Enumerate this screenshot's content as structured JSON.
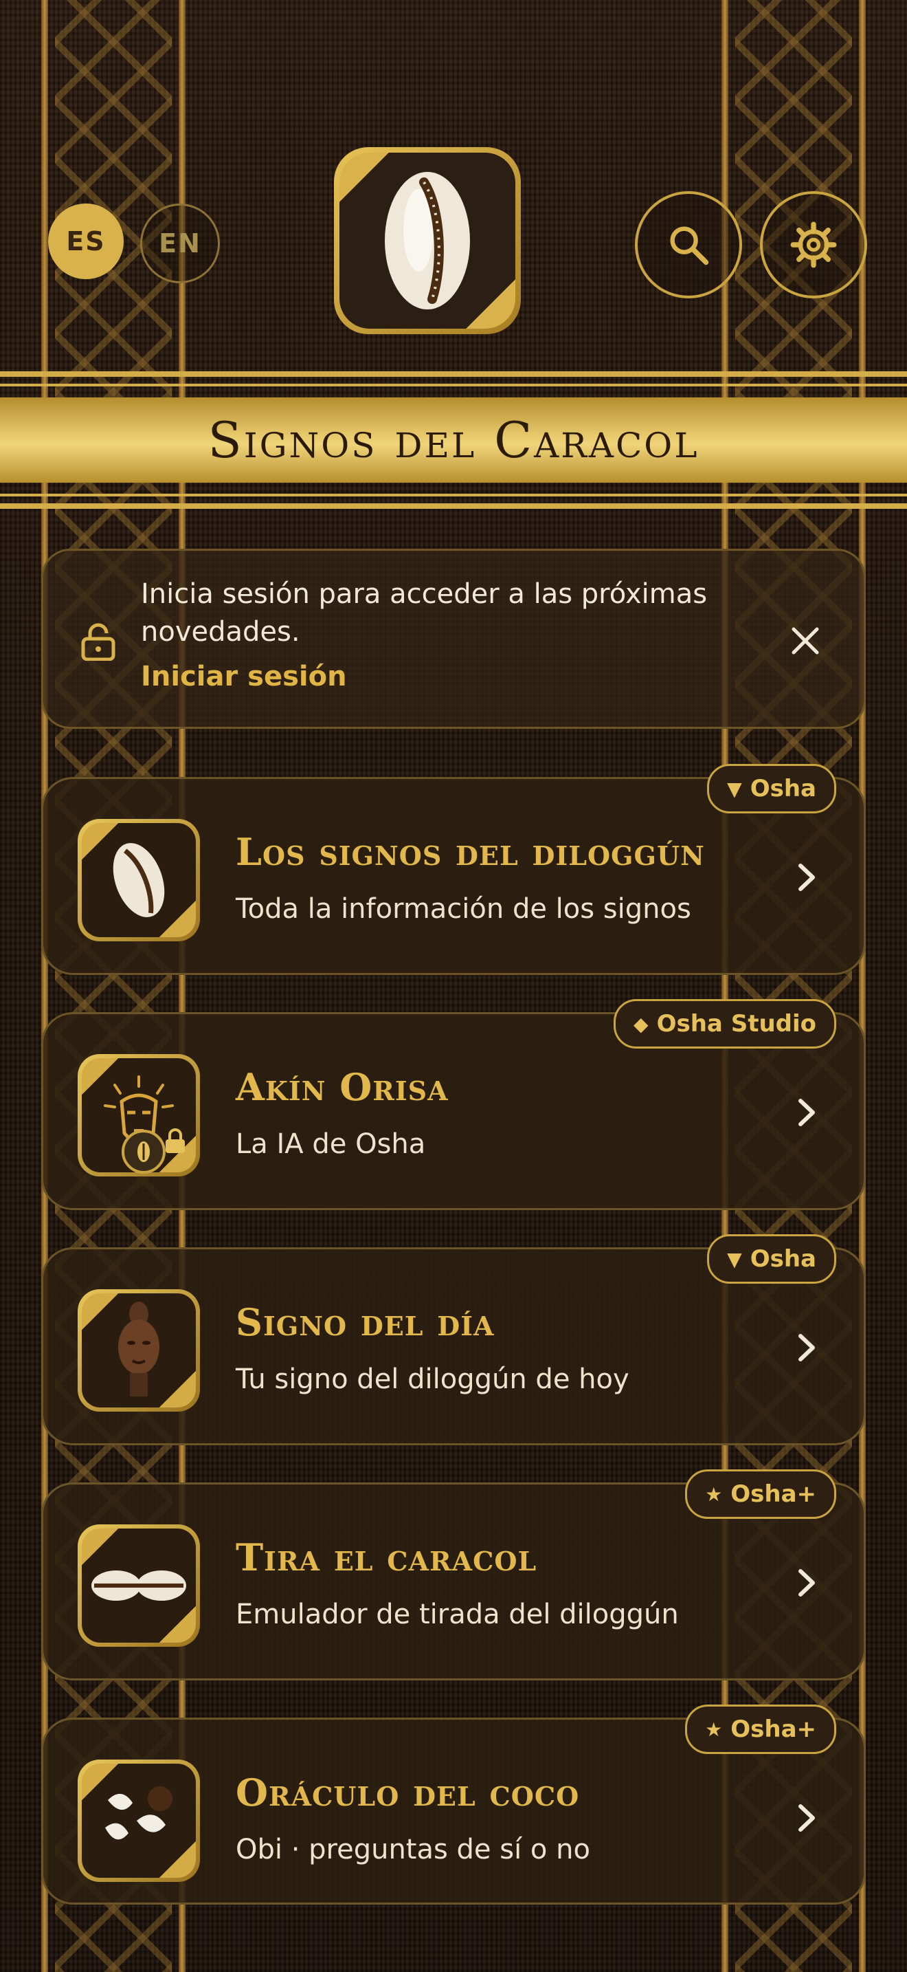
{
  "header": {
    "lang_es": "ES",
    "lang_en": "EN",
    "search_icon": "search-icon",
    "settings_icon": "gear-icon",
    "logo_icon": "cowrie-shell-icon"
  },
  "banner": {
    "title": "Signos del Caracol"
  },
  "notice": {
    "message": "Inicia sesión para acceder a las próximas novedades.",
    "action": "Iniciar sesión"
  },
  "cards": [
    {
      "title": "Los signos del diloggún",
      "subtitle": "Toda la información de los signos",
      "badge": "Osha",
      "badge_icon": "hand-icon"
    },
    {
      "title": "Akín Orisa",
      "subtitle": "La IA de Osha",
      "badge": "Osha Studio",
      "badge_icon": "diamond-icon"
    },
    {
      "title": "Signo del día",
      "subtitle": "Tu signo del diloggún de hoy",
      "badge": "Osha",
      "badge_icon": "hand-icon"
    },
    {
      "title": "Tira el caracol",
      "subtitle": "Emulador de tirada del diloggún",
      "badge": "Osha+",
      "badge_icon": "star-icon"
    },
    {
      "title": "Oráculo del coco",
      "subtitle": "Obi · preguntas de sí o no",
      "badge": "Osha+",
      "badge_icon": "star-icon"
    }
  ],
  "colors": {
    "gold": "#d9b24c",
    "dark": "#2a1a0e",
    "text": "#eee3cc"
  }
}
